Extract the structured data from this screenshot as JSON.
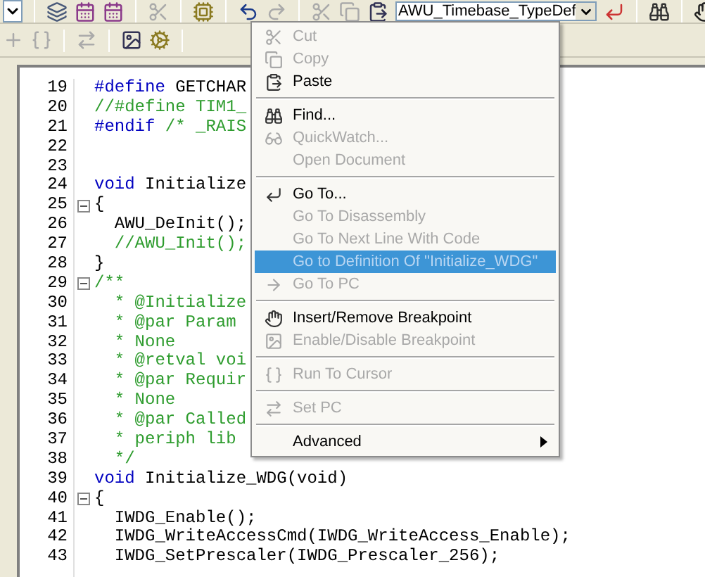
{
  "toolbar": {
    "symbol_combo": {
      "value": "AWU_Timebase_TypeDef"
    }
  },
  "editor": {
    "lines": [
      {
        "number": "19",
        "fold": false,
        "segments": [
          {
            "text": "#define",
            "kind": "keyword"
          },
          {
            "text": " GETCHAR",
            "kind": "plain"
          }
        ]
      },
      {
        "number": "20",
        "fold": false,
        "segments": [
          {
            "text": "//#define TIM1_",
            "kind": "comment"
          }
        ]
      },
      {
        "number": "21",
        "fold": false,
        "segments": [
          {
            "text": "#endif",
            "kind": "keyword"
          },
          {
            "text": " /* _RAIS",
            "kind": "comment"
          }
        ]
      },
      {
        "number": "22",
        "fold": false
      },
      {
        "number": "23",
        "fold": false
      },
      {
        "number": "24",
        "fold": false,
        "segments": [
          {
            "text": "void",
            "kind": "keyword"
          },
          {
            "text": " Initialize",
            "kind": "plain"
          }
        ]
      },
      {
        "number": "25",
        "fold": true,
        "segments": [
          {
            "text": "{",
            "kind": "plain"
          }
        ]
      },
      {
        "number": "26",
        "fold": false,
        "segments": [
          {
            "text": "  AWU_DeInit();",
            "kind": "plain"
          }
        ]
      },
      {
        "number": "27",
        "fold": false,
        "segments": [
          {
            "text": "  //AWU_Init();",
            "kind": "comment"
          }
        ]
      },
      {
        "number": "28",
        "fold": false,
        "segments": [
          {
            "text": "}",
            "kind": "plain"
          }
        ]
      },
      {
        "number": "29",
        "fold": true,
        "segments": [
          {
            "text": "/**",
            "kind": "comment"
          }
        ]
      },
      {
        "number": "30",
        "fold": false,
        "segments": [
          {
            "text": "  * @Initialize",
            "kind": "comment"
          }
        ]
      },
      {
        "number": "31",
        "fold": false,
        "segments": [
          {
            "text": "  * @par Param",
            "kind": "comment"
          }
        ]
      },
      {
        "number": "32",
        "fold": false,
        "segments": [
          {
            "text": "  * None",
            "kind": "comment"
          }
        ]
      },
      {
        "number": "33",
        "fold": false,
        "segments": [
          {
            "text": "  * @retval voi",
            "kind": "comment"
          }
        ]
      },
      {
        "number": "34",
        "fold": false,
        "segments": [
          {
            "text": "  * @par Requir",
            "kind": "comment"
          }
        ]
      },
      {
        "number": "35",
        "fold": false,
        "segments": [
          {
            "text": "  * None",
            "kind": "comment"
          }
        ]
      },
      {
        "number": "36",
        "fold": false,
        "segments": [
          {
            "text": "  * @par Called",
            "kind": "comment"
          }
        ]
      },
      {
        "number": "37",
        "fold": false,
        "segments": [
          {
            "text": "  * periph lib",
            "kind": "comment"
          }
        ]
      },
      {
        "number": "38",
        "fold": false,
        "segments": [
          {
            "text": "  */",
            "kind": "comment"
          }
        ]
      },
      {
        "number": "39",
        "fold": false,
        "segments": [
          {
            "text": "void",
            "kind": "keyword"
          },
          {
            "text": " Initialize_WDG(void)",
            "kind": "plain"
          }
        ]
      },
      {
        "number": "40",
        "fold": true,
        "segments": [
          {
            "text": "{",
            "kind": "plain"
          }
        ]
      },
      {
        "number": "41",
        "fold": false,
        "segments": [
          {
            "text": "  IWDG_Enable();",
            "kind": "plain"
          }
        ]
      },
      {
        "number": "42",
        "fold": false,
        "segments": [
          {
            "text": "  IWDG_WriteAccessCmd(IWDG_WriteAccess_Enable);",
            "kind": "plain"
          }
        ]
      },
      {
        "number": "43",
        "fold": false,
        "segments": [
          {
            "text": "  IWDG_SetPrescaler(IWDG_Prescaler_256);",
            "kind": "plain"
          }
        ]
      }
    ]
  },
  "context_menu": {
    "items": [
      {
        "kind": "item",
        "label": "Cut",
        "disabled": true,
        "selected": false,
        "submenu": false
      },
      {
        "kind": "item",
        "label": "Copy",
        "disabled": true,
        "selected": false,
        "submenu": false
      },
      {
        "kind": "item",
        "label": "Paste",
        "disabled": false,
        "selected": false,
        "submenu": false
      },
      {
        "kind": "separator"
      },
      {
        "kind": "item",
        "label": "Find...",
        "disabled": false,
        "selected": false,
        "submenu": false
      },
      {
        "kind": "item",
        "label": "QuickWatch...",
        "disabled": true,
        "selected": false,
        "submenu": false
      },
      {
        "kind": "item",
        "label": "Open Document",
        "disabled": true,
        "selected": false,
        "submenu": false
      },
      {
        "kind": "separator"
      },
      {
        "kind": "item",
        "label": "Go To...",
        "disabled": false,
        "selected": false,
        "submenu": false
      },
      {
        "kind": "item",
        "label": "Go To Disassembly",
        "disabled": true,
        "selected": false,
        "submenu": false
      },
      {
        "kind": "item",
        "label": "Go To Next Line With Code",
        "disabled": true,
        "selected": false,
        "submenu": false
      },
      {
        "kind": "item",
        "label": "Go to Definition Of \"Initialize_WDG\"",
        "disabled": true,
        "selected": true,
        "submenu": false
      },
      {
        "kind": "item",
        "label": "Go To PC",
        "disabled": true,
        "selected": false,
        "submenu": false
      },
      {
        "kind": "separator"
      },
      {
        "kind": "item",
        "label": "Insert/Remove Breakpoint",
        "disabled": false,
        "selected": false,
        "submenu": false
      },
      {
        "kind": "item",
        "label": "Enable/Disable Breakpoint",
        "disabled": true,
        "selected": false,
        "submenu": false
      },
      {
        "kind": "separator"
      },
      {
        "kind": "item",
        "label": "Run To Cursor",
        "disabled": true,
        "selected": false,
        "submenu": false
      },
      {
        "kind": "separator"
      },
      {
        "kind": "item",
        "label": "Set PC",
        "disabled": true,
        "selected": false,
        "submenu": false
      },
      {
        "kind": "separator"
      },
      {
        "kind": "item",
        "label": "Advanced",
        "disabled": false,
        "selected": false,
        "submenu": true
      }
    ]
  }
}
